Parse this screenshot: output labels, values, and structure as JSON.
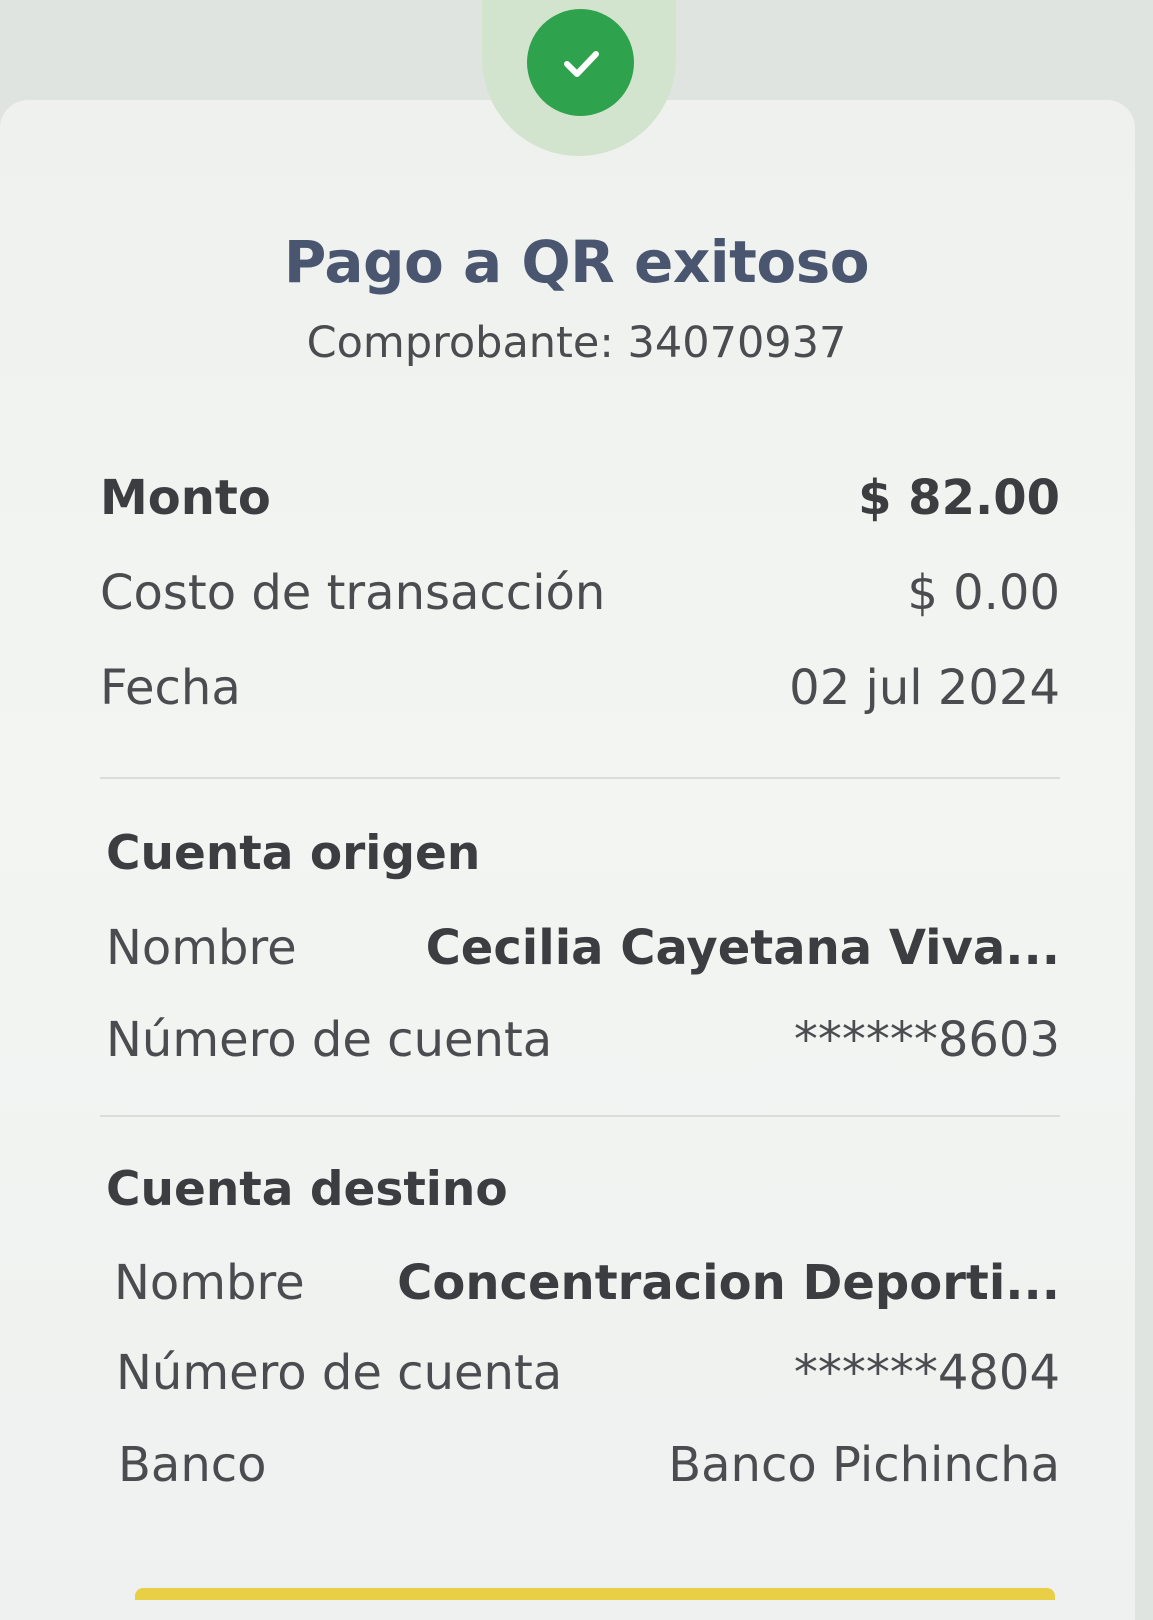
{
  "status": {
    "icon": "checkmark-icon",
    "color": "#2ea24c",
    "title": "Pago a QR exitoso",
    "receipt": "Comprobante: 34070937"
  },
  "summary": {
    "amount_label": "Monto",
    "amount_value": "$ 82.00",
    "fee_label": "Costo de transacción",
    "fee_value": "$ 0.00",
    "date_label": "Fecha",
    "date_value": "02 jul 2024"
  },
  "origin": {
    "section_title": "Cuenta origen",
    "name_label": "Nombre",
    "name_value": "Cecilia Cayetana Viva...",
    "account_label": "Número de cuenta",
    "account_value": "******8603"
  },
  "destination": {
    "section_title": "Cuenta destino",
    "name_label": "Nombre",
    "name_value": "Concentracion Deporti...",
    "account_label": "Número de cuenta",
    "account_value": "******4804",
    "bank_label": "Banco",
    "bank_value": "Banco Pichincha"
  }
}
